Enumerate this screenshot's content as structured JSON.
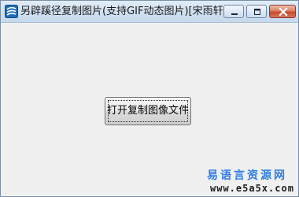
{
  "window": {
    "title": "另辟蹊径复制图片(支持GIF动态图片)[宋雨轩]",
    "icon": "app-icon",
    "controls": {
      "minimize_icon": "minimize-icon",
      "maximize_icon": "maximize-icon",
      "close_icon": "close-icon"
    }
  },
  "main": {
    "open_button_label": "打开复制图像文件"
  },
  "watermark": {
    "site_name": "易语言资源网",
    "url": "www.e5a5x.com"
  }
}
